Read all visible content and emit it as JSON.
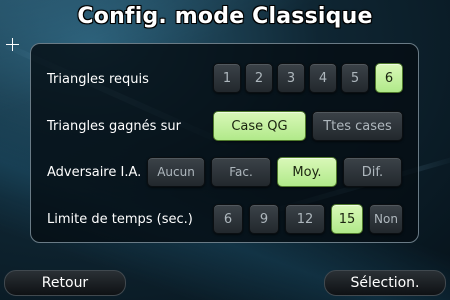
{
  "title": "Config. mode Classique",
  "rows": {
    "triangles_requis": {
      "label": "Triangles requis",
      "options": [
        "1",
        "2",
        "3",
        "4",
        "5",
        "6"
      ],
      "selected": "6"
    },
    "triangles_gagnes": {
      "label": "Triangles gagnés sur",
      "options": [
        "Case QG",
        "Ttes cases"
      ],
      "selected": "Case QG"
    },
    "adversaire": {
      "label": "Adversaire I.A.",
      "options": [
        "Aucun",
        "Fac.",
        "Moy.",
        "Dif."
      ],
      "selected": "Moy."
    },
    "limite_temps": {
      "label": "Limite de temps (sec.)",
      "options": [
        "6",
        "9",
        "12",
        "15",
        "Non"
      ],
      "selected": "15"
    }
  },
  "bottom": {
    "back_label": "Retour",
    "select_label": "Sélection."
  },
  "colors": {
    "selected_button": "#c4f0a0",
    "normal_button": "#2e353a"
  }
}
